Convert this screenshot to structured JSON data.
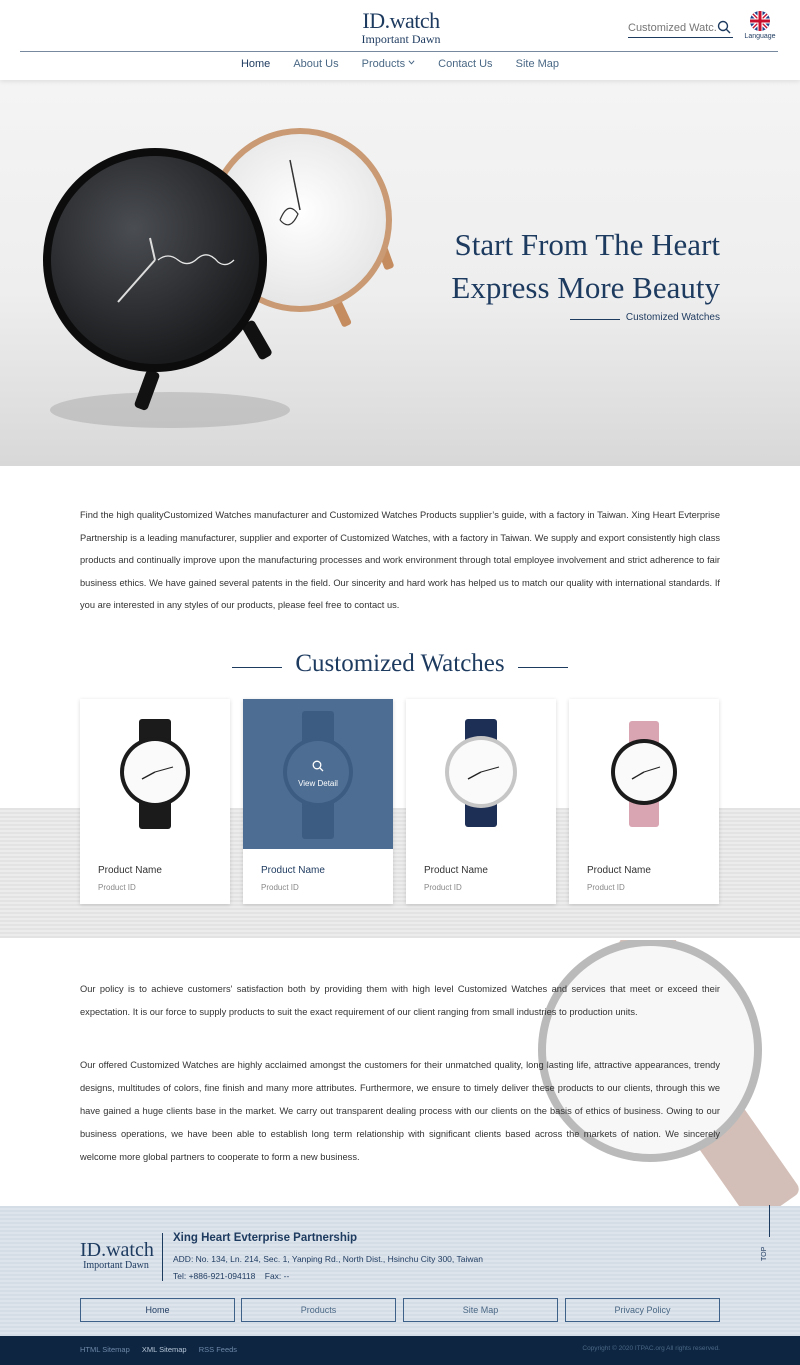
{
  "header": {
    "logo_line1": "ID.watch",
    "logo_line2": "Important Dawn",
    "search_placeholder": "Customized Watc...",
    "language_label": "Language",
    "nav": [
      {
        "label": "Home"
      },
      {
        "label": "About Us"
      },
      {
        "label": "Products"
      },
      {
        "label": "Contact Us"
      },
      {
        "label": "Site Map"
      }
    ]
  },
  "hero": {
    "title_line1": "Start From The Heart",
    "title_line2": "Express More Beauty",
    "subtitle": "Customized Watches"
  },
  "intro": "Find the high qualityCustomized Watches manufacturer and Customized Watches Products supplier’s guide, with a factory in Taiwan. Xing Heart Evterprise Partnership is a leading manufacturer, supplier and exporter of Customized Watches, with a factory in Taiwan. We supply and export consistently high class products and continually improve upon the manufacturing processes and work environment through total employee involvement and strict adherence to fair business ethics. We have gained several patents in the field. Our sincerity and hard work has helped us to match our quality with international standards. If you are interested in any styles of our products, please feel free to contact us.",
  "section_title": "Customized Watches",
  "products": [
    {
      "name": "Product Name",
      "id": "Product ID",
      "strap_color": "#1b1b1b"
    },
    {
      "name": "Product Name",
      "id": "Product ID",
      "strap_color": "#2a2a2a",
      "overlay_text": "View Detail"
    },
    {
      "name": "Product Name",
      "id": "Product ID",
      "strap_color": "#1e2f55"
    },
    {
      "name": "Product Name",
      "id": "Product ID",
      "strap_color": "#d9a5b2"
    }
  ],
  "policy": {
    "p1": "Our policy is to achieve customers' satisfaction both by providing them with high level Customized Watches and services that meet or exceed their expectation. It is our force to supply products to suit the exact requirement of our client ranging from small industries to production units.",
    "p2": "Our offered Customized Watches are highly acclaimed amongst the customers for their unmatched quality, long lasting life, attractive appearances, trendy designs, multitudes of colors, fine finish and many more attributes. Furthermore, we ensure to timely deliver these products to our clients, through this we have gained a huge clients base in the market. We carry out transparent dealing process with our clients on the basis of ethics of business. Owing to our business operations, we have been able to establish long term relationship with significant clients based across the markets of nation. We sincerely welcome more global partners to cooperate to form a new business."
  },
  "footer": {
    "logo_line1": "ID.watch",
    "logo_line2": "Important Dawn",
    "company": "Xing Heart Evterprise Partnership",
    "address": "ADD: No. 134, Ln. 214, Sec. 1, Yanping Rd., North Dist., Hsinchu City 300, Taiwan",
    "tel": "Tel: +886-921-094118    Fax: --",
    "top_label": "TOP",
    "buttons": [
      {
        "label": "Home"
      },
      {
        "label": "Products"
      },
      {
        "label": "Site Map"
      },
      {
        "label": "Privacy Policy"
      }
    ],
    "bottom_links": [
      {
        "label": "HTML Sitemap"
      },
      {
        "label": "XML Sitemap"
      },
      {
        "label": "RSS Feeds"
      }
    ],
    "copyright": "Copyright © 2020 ITPAC.org All rights reserved."
  },
  "colors": {
    "brand": "#1d3a5f",
    "hover_overlay": "#3e6189",
    "bottom_bar": "#0d2541"
  }
}
